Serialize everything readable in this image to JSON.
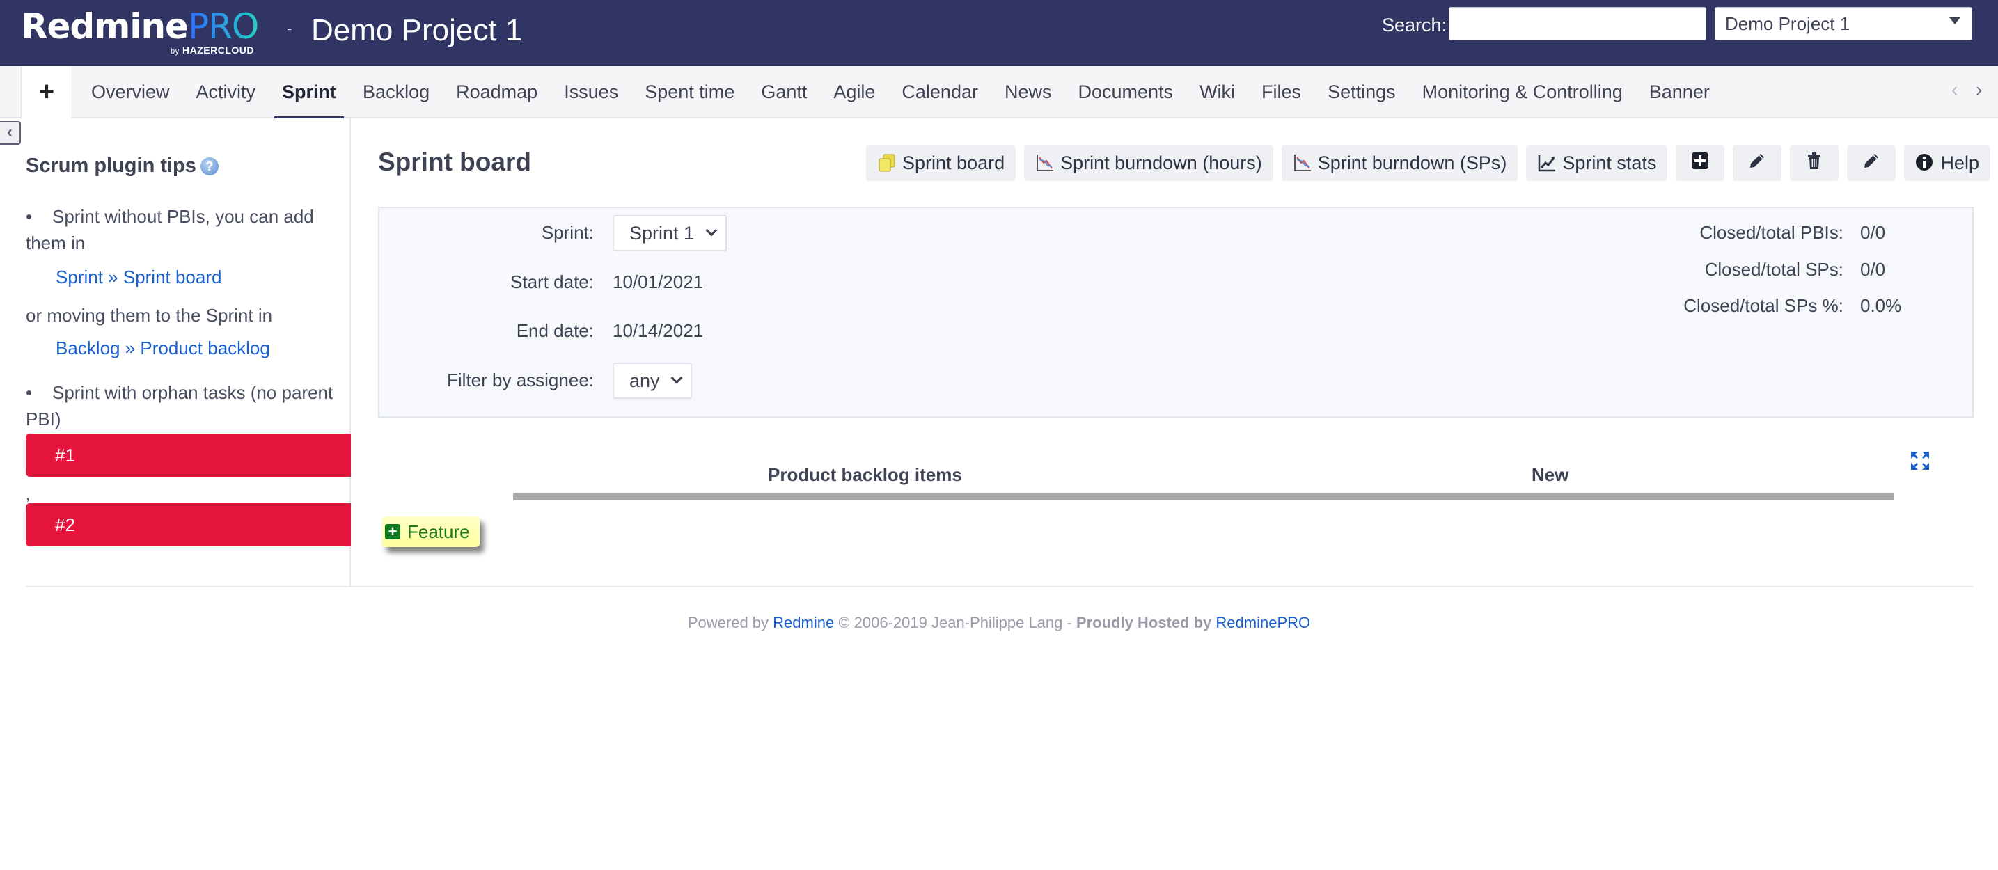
{
  "header": {
    "logo_main": "Redmine",
    "logo_pro": "PRO",
    "logo_sub_by": "by",
    "logo_sub_brand": "HAZERCLOUD",
    "separator": "-",
    "project_title": "Demo Project 1",
    "search_label": "Search:",
    "search_value": "",
    "project_jump_value": "Demo Project 1"
  },
  "menu": {
    "new_object_label": "+",
    "tabs": [
      {
        "label": "Overview"
      },
      {
        "label": "Activity"
      },
      {
        "label": "Sprint",
        "selected": true
      },
      {
        "label": "Backlog"
      },
      {
        "label": "Roadmap"
      },
      {
        "label": "Issues"
      },
      {
        "label": "Spent time"
      },
      {
        "label": "Gantt"
      },
      {
        "label": "Agile"
      },
      {
        "label": "Calendar"
      },
      {
        "label": "News"
      },
      {
        "label": "Documents"
      },
      {
        "label": "Wiki"
      },
      {
        "label": "Files"
      },
      {
        "label": "Settings"
      },
      {
        "label": "Monitoring & Controlling"
      },
      {
        "label": "Banner"
      }
    ],
    "scroll_left": "‹",
    "scroll_right": "›"
  },
  "sidebar": {
    "toggle": "‹",
    "title": "Scrum plugin tips",
    "help_icon": "?",
    "tip1_text": "Sprint without PBIs, you can add them in",
    "tip1_link": "Sprint » Sprint board",
    "tip1_or": "or moving them to the Sprint in",
    "tip1_link2": "Backlog » Product backlog",
    "tip2_text": "Sprint with orphan tasks (no parent PBI)",
    "orphans": [
      "#1",
      "#2"
    ],
    "orphan_separator": ","
  },
  "main": {
    "title": "Sprint board",
    "toolbar": {
      "sprint_board": "Sprint board",
      "burndown_hours": "Sprint burndown (hours)",
      "burndown_sps": "Sprint burndown (SPs)",
      "sprint_stats": "Sprint stats",
      "help": "Help"
    },
    "info": {
      "sprint_label": "Sprint:",
      "sprint_value": "Sprint 1",
      "start_label": "Start date:",
      "start_value": "10/01/2021",
      "end_label": "End date:",
      "end_value": "10/14/2021",
      "assignee_label": "Filter by assignee:",
      "assignee_value": "any",
      "pbis_label": "Closed/total PBIs:",
      "pbis_value": "0/0",
      "sps_label": "Closed/total SPs:",
      "sps_value": "0/0",
      "sps_pct_label": "Closed/total SPs %:",
      "sps_pct_value": "0.0%"
    },
    "board": {
      "columns": [
        "Product backlog items",
        "New"
      ],
      "feature_label": "Feature"
    }
  },
  "footer": {
    "powered_by": "Powered by",
    "redmine_link": "Redmine",
    "copyright": "© 2006-2019 Jean-Philippe Lang -",
    "hosted_by": "Proudly Hosted by",
    "redminepro_link": "RedminePRO"
  },
  "colors": {
    "header_bg": "#303564",
    "link": "#1a5fcf",
    "orphan_bg": "#e4143d",
    "feature_bg": "#ffffb0",
    "feature_text": "#1f7a1f"
  }
}
